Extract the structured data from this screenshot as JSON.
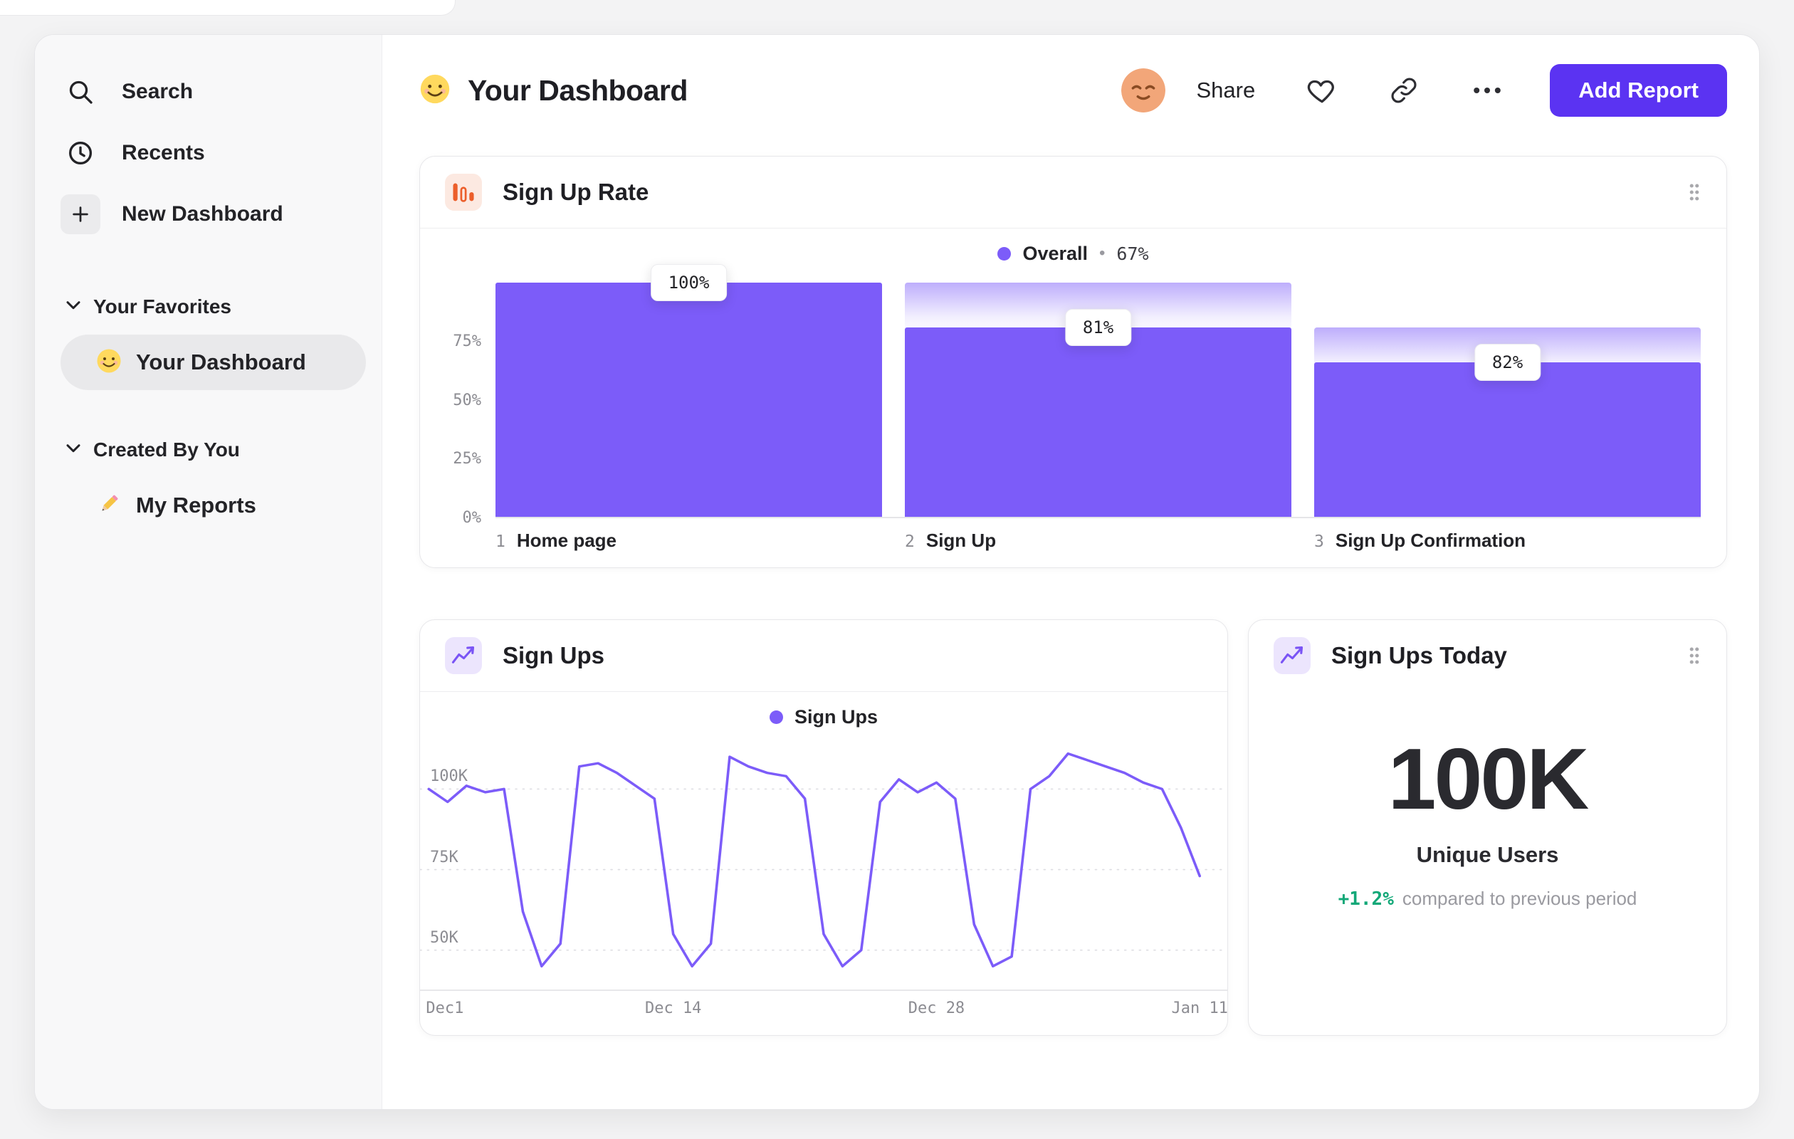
{
  "sidebar": {
    "items": [
      {
        "label": "Search"
      },
      {
        "label": "Recents"
      },
      {
        "label": "New Dashboard"
      }
    ],
    "sections": [
      {
        "title": "Your Favorites",
        "items": [
          {
            "label": "Your Dashboard",
            "selected": true,
            "icon": "smiley-emoji"
          }
        ]
      },
      {
        "title": "Created By You",
        "items": [
          {
            "label": "My Reports",
            "selected": false,
            "icon": "pencil-emoji"
          }
        ]
      }
    ]
  },
  "header": {
    "title": "Your Dashboard",
    "share_label": "Share",
    "add_report_label": "Add Report"
  },
  "colors": {
    "accent_purple": "#7C5CF9",
    "button_indigo": "#5B33F2",
    "funnel_icon_orange": "#EC5E2A",
    "delta_green": "#13A878"
  },
  "chart_data": [
    {
      "type": "bar",
      "subtype": "funnel",
      "title": "Sign Up Rate",
      "legend_label": "Overall",
      "legend_sep": "•",
      "legend_value": "67%",
      "ylim": [
        0,
        100
      ],
      "yticks": [
        {
          "label": "75%",
          "v": 75
        },
        {
          "label": "50%",
          "v": 50
        },
        {
          "label": "25%",
          "v": 25
        },
        {
          "label": "0%",
          "v": 0
        }
      ],
      "steps": [
        {
          "index": "1",
          "label": "Home page",
          "overall_pct": 100,
          "step_pct_label": "100%"
        },
        {
          "index": "2",
          "label": "Sign Up",
          "overall_pct": 81,
          "step_pct_label": "81%"
        },
        {
          "index": "3",
          "label": "Sign Up Confirmation",
          "overall_pct": 66,
          "step_pct_label": "82%"
        }
      ]
    },
    {
      "type": "line",
      "title": "Sign Ups",
      "x_range_days": [
        0,
        42
      ],
      "ylim_k": [
        38,
        114
      ],
      "y_ticks": [
        {
          "label": "100K",
          "v": 100
        },
        {
          "label": "75K",
          "v": 75
        },
        {
          "label": "50K",
          "v": 50
        }
      ],
      "x_ticks": [
        {
          "label": "Dec1",
          "d": 0
        },
        {
          "label": "Dec 14",
          "d": 13
        },
        {
          "label": "Dec 28",
          "d": 27
        },
        {
          "label": "Jan 11",
          "d": 41
        }
      ],
      "series": [
        {
          "name": "Sign Ups",
          "x_days": [
            0,
            1,
            2,
            3,
            4,
            5,
            6,
            7,
            8,
            9,
            10,
            11,
            12,
            13,
            14,
            15,
            16,
            17,
            18,
            19,
            20,
            21,
            22,
            23,
            24,
            25,
            26,
            27,
            28,
            29,
            30,
            31,
            32,
            33,
            34,
            35,
            36,
            37,
            38,
            39,
            40,
            41
          ],
          "values_k": [
            100,
            96,
            101,
            99,
            100,
            62,
            45,
            52,
            107,
            108,
            105,
            101,
            97,
            55,
            45,
            52,
            110,
            107,
            105,
            104,
            97,
            55,
            45,
            50,
            96,
            103,
            99,
            102,
            97,
            58,
            45,
            48,
            100,
            104,
            111,
            109,
            107,
            105,
            102,
            100,
            88,
            73
          ]
        }
      ]
    },
    {
      "type": "stat",
      "title": "Sign Ups Today",
      "value": "100K",
      "unit_label": "Unique Users",
      "delta": "+1.2%",
      "delta_note": "compared to previous period"
    }
  ]
}
